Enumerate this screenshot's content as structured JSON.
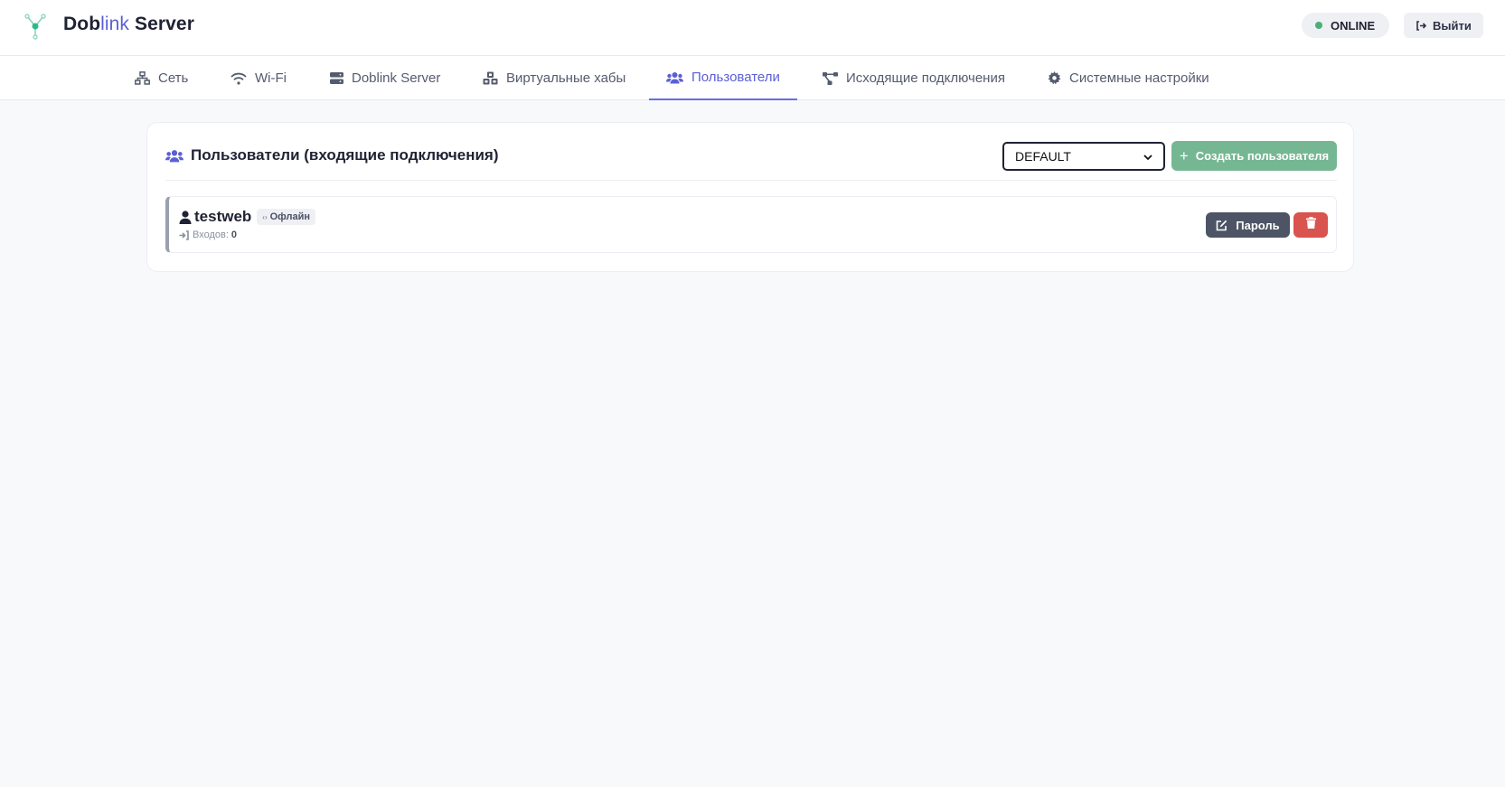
{
  "header": {
    "brand_part1": "Dob",
    "brand_part2": "link",
    "brand_part3": " Server",
    "status": "ONLINE",
    "status_color": "#4caf77",
    "logout_label": "Выйти",
    "logout_icon": "sign-out-icon",
    "logo_icon": "network-node-icon"
  },
  "nav": {
    "tabs": [
      {
        "label": "Сеть",
        "icon": "network-icon"
      },
      {
        "label": "Wi-Fi",
        "icon": "wifi-icon"
      },
      {
        "label": "Doblink Server",
        "icon": "server-icon"
      },
      {
        "label": "Виртуальные хабы",
        "icon": "cubes-icon"
      },
      {
        "label": "Пользователи",
        "icon": "users-icon",
        "active": true
      },
      {
        "label": "Исходящие подключения",
        "icon": "project-diagram-icon"
      },
      {
        "label": "Системные настройки",
        "icon": "gear-icon"
      }
    ],
    "accent_color": "#5b5fd6"
  },
  "users_panel": {
    "title": "Пользователи (входящие подключения)",
    "title_icon": "users-icon",
    "hub_select": {
      "selected": "DEFAULT"
    },
    "create_button": "Создать пользователя",
    "users": [
      {
        "name": "testweb",
        "status": "Офлайн",
        "logins_label": "Входов:",
        "logins_count": "0",
        "password_button": "Пароль",
        "delete_icon": "trash-icon"
      }
    ]
  }
}
